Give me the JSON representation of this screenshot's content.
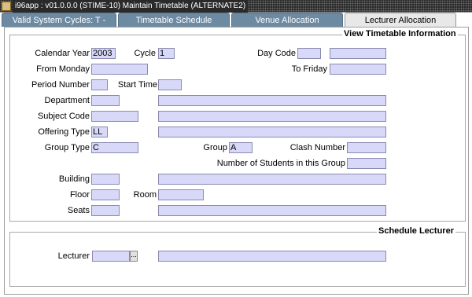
{
  "window": {
    "title": "i96app : v01.0.0.0 (STIME-10) Maintain Timetable  (ALTERNATE2)",
    "icon": "app-icon"
  },
  "tabs": [
    {
      "label": "Valid System Cycles: T - Type"
    },
    {
      "label": "Timetable Schedule"
    },
    {
      "label": "Venue Allocation"
    },
    {
      "label": "Lecturer Allocation"
    }
  ],
  "timetable": {
    "section_title": "View Timetable Information",
    "calendar_year": {
      "label": "Calendar Year",
      "value": "2003"
    },
    "cycle": {
      "label": "Cycle",
      "value": "1"
    },
    "day_code": {
      "label": "Day Code",
      "value": "",
      "desc": ""
    },
    "from_monday": {
      "label": "From Monday",
      "value": ""
    },
    "to_friday": {
      "label": "To Friday",
      "value": ""
    },
    "period_number": {
      "label": "Period Number",
      "value": ""
    },
    "start_time": {
      "label": "Start Time",
      "value": ""
    },
    "department": {
      "label": "Department",
      "value": "",
      "desc": ""
    },
    "subject_code": {
      "label": "Subject Code",
      "value": "",
      "desc": ""
    },
    "offering_type": {
      "label": "Offering Type",
      "value": "LL",
      "desc": ""
    },
    "group_type": {
      "label": "Group Type",
      "value": "C"
    },
    "group": {
      "label": "Group",
      "value": "A"
    },
    "clash_number": {
      "label": "Clash Number",
      "value": ""
    },
    "num_students": {
      "label": "Number of Students in this Group",
      "value": ""
    },
    "building": {
      "label": "Building",
      "value": "",
      "desc": ""
    },
    "floor": {
      "label": "Floor",
      "value": ""
    },
    "room": {
      "label": "Room",
      "value": ""
    },
    "seats": {
      "label": "Seats",
      "value": "",
      "desc": ""
    }
  },
  "schedule": {
    "section_title": "Schedule Lecturer",
    "lecturer": {
      "label": "Lecturer",
      "value": "",
      "desc": "",
      "lov_label": "..."
    }
  }
}
